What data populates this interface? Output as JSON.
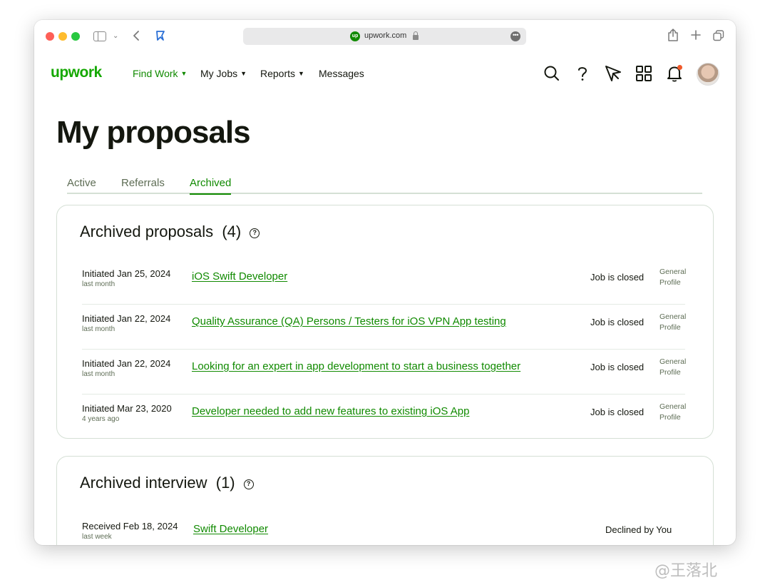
{
  "browser": {
    "url": "upwork.com",
    "favicon_text": "up"
  },
  "header": {
    "logo": "upwork",
    "nav": [
      {
        "label": "Find Work",
        "has_dropdown": true,
        "active": true
      },
      {
        "label": "My Jobs",
        "has_dropdown": true
      },
      {
        "label": "Reports",
        "has_dropdown": true
      },
      {
        "label": "Messages",
        "has_dropdown": false
      }
    ],
    "icons": [
      "search-icon",
      "help-icon",
      "send-icon",
      "apps-grid-icon",
      "bell-icon",
      "avatar"
    ],
    "notification_dot_color": "#f0592a"
  },
  "page": {
    "title": "My proposals",
    "tabs": [
      {
        "label": "Active"
      },
      {
        "label": "Referrals"
      },
      {
        "label": "Archived",
        "active": true
      }
    ]
  },
  "archived_proposals": {
    "title": "Archived proposals",
    "count": "(4)",
    "rows": [
      {
        "date": "Initiated Jan 25, 2024",
        "ago": "last month",
        "job": "iOS Swift Developer",
        "status": "Job is closed",
        "profile_line1": "General",
        "profile_line2": "Profile"
      },
      {
        "date": "Initiated Jan 22, 2024",
        "ago": "last month",
        "job": "Quality Assurance (QA) Persons / Testers for iOS VPN App testing",
        "status": "Job is closed",
        "profile_line1": "General",
        "profile_line2": "Profile"
      },
      {
        "date": "Initiated Jan 22, 2024",
        "ago": "last month",
        "job": "Looking for an expert in app development to start a business together",
        "status": "Job is closed",
        "profile_line1": "General",
        "profile_line2": "Profile"
      },
      {
        "date": "Initiated Mar 23, 2020",
        "ago": "4 years ago",
        "job": "Developer needed to add new features to existing iOS App",
        "status": "Job is closed",
        "profile_line1": "General",
        "profile_line2": "Profile"
      }
    ]
  },
  "archived_interview": {
    "title": "Archived interview",
    "count": "(1)",
    "rows": [
      {
        "date": "Received Feb 18, 2024",
        "ago": "last week",
        "job": "Swift Developer",
        "status": "Declined by You"
      }
    ]
  },
  "colors": {
    "brand_green": "#14a800",
    "link_green": "#108a00",
    "text": "#14170f",
    "muted": "#5e6d55"
  },
  "watermark": "@王落北"
}
